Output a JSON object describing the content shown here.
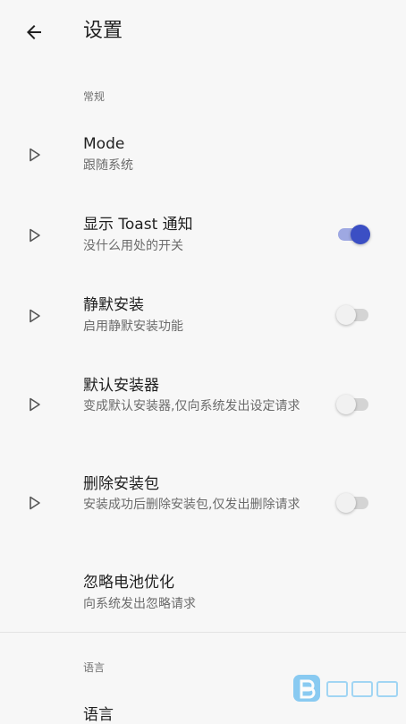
{
  "appbar": {
    "title": "设置",
    "back_icon": "arrow-left-icon"
  },
  "sections": {
    "general": "常规",
    "language": "语言"
  },
  "prefs": [
    {
      "title": "Mode",
      "summary": "跟随系统"
    },
    {
      "title": "显示 Toast 通知",
      "summary": "没什么用处的开关",
      "switch": "on"
    },
    {
      "title": "静默安装",
      "summary": "启用静默安装功能",
      "switch": "off"
    },
    {
      "title": "默认安装器",
      "summary": "变成默认安装器,仅向系统发出设定请求",
      "switch": "off"
    },
    {
      "title": "删除安装包",
      "summary": "安装成功后删除安装包,仅发出删除请求",
      "switch": "off"
    },
    {
      "title": "忽略电池优化",
      "summary": "向系统发出忽略请求"
    }
  ],
  "partial_item": {
    "title": "语言"
  },
  "colors": {
    "accent": "#3b4fc4",
    "accent_track": "#9ea8e2",
    "background": "#f7f7f7"
  },
  "watermark": {
    "brand_icon": "brand-logo-icon"
  }
}
